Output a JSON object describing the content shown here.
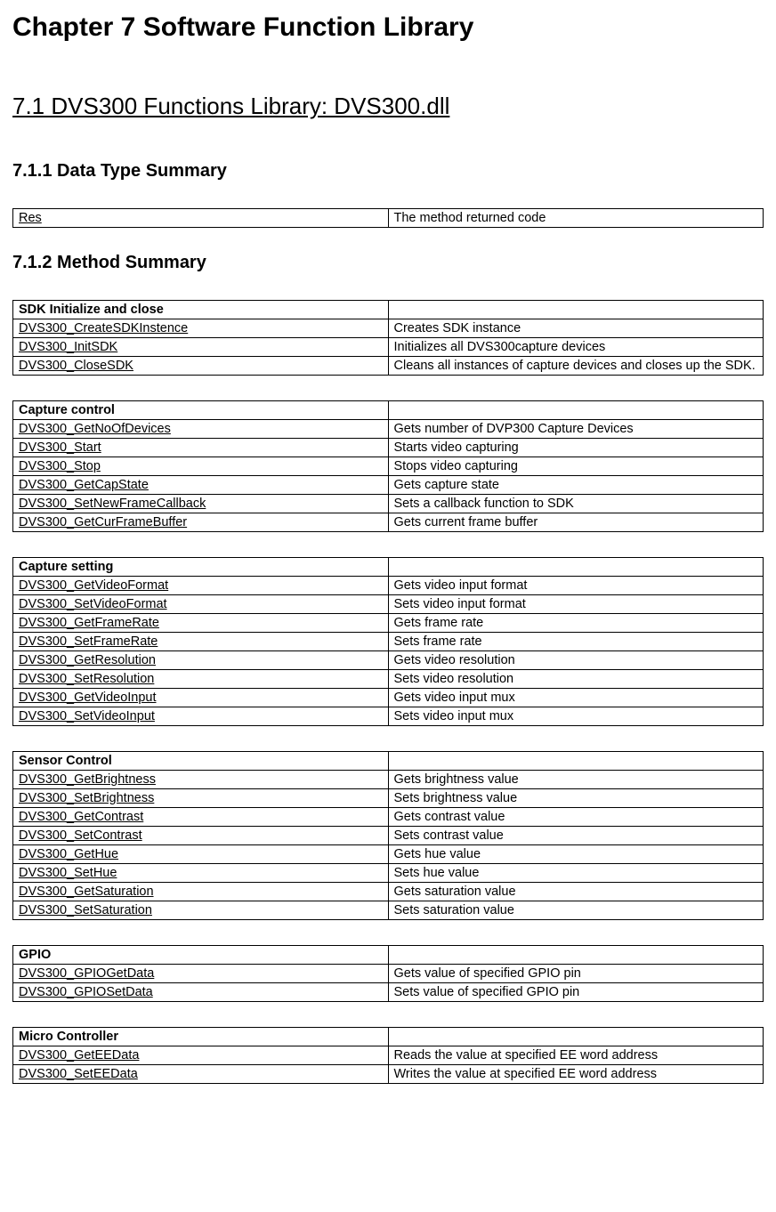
{
  "headings": {
    "chapter": "Chapter 7  Software Function Library",
    "section71": "7.1 DVS300 Functions Library: DVS300.dll",
    "section711": "7.1.1 Data Type Summary",
    "section712": "7.1.2 Method Summary"
  },
  "dataTypeTable": {
    "rows": [
      {
        "name": "Res",
        "desc": "The method returned code"
      }
    ]
  },
  "methodTables": [
    {
      "header": "SDK Initialize and close",
      "rows": [
        {
          "name": "DVS300_CreateSDKInstence",
          "desc": "Creates SDK instance"
        },
        {
          "name": "DVS300_InitSDK",
          "desc": "Initializes all DVS300capture devices"
        },
        {
          "name": "DVS300_CloseSDK",
          "desc": "Cleans all instances of capture devices and closes up the SDK."
        }
      ]
    },
    {
      "header": "Capture control",
      "rows": [
        {
          "name": "DVS300_GetNoOfDevices",
          "desc": "Gets number of DVP300 Capture Devices"
        },
        {
          "name": "DVS300_Start",
          "desc": "Starts video capturing"
        },
        {
          "name": "DVS300_Stop",
          "desc": "Stops video capturing"
        },
        {
          "name": "DVS300_GetCapState",
          "desc": "Gets capture state"
        },
        {
          "name": "DVS300_SetNewFrameCallback",
          "desc": "Sets a callback function to SDK"
        },
        {
          "name": "DVS300_GetCurFrameBuffer",
          "desc": "Gets current frame buffer"
        }
      ]
    },
    {
      "header": "Capture setting",
      "rows": [
        {
          "name": "DVS300_GetVideoFormat",
          "desc": "Gets video input format"
        },
        {
          "name": "DVS300_SetVideoFormat",
          "desc": "Sets video input format"
        },
        {
          "name": "DVS300_GetFrameRate",
          "desc": "Gets frame rate"
        },
        {
          "name": "DVS300_SetFrameRate",
          "desc": "Sets frame rate"
        },
        {
          "name": "DVS300_GetResolution",
          "desc": "Gets video resolution"
        },
        {
          "name": "DVS300_SetResolution",
          "desc": "Sets video resolution"
        },
        {
          "name": "DVS300_GetVideoInput",
          "desc": "Gets video input mux"
        },
        {
          "name": "DVS300_SetVideoInput",
          "desc": "Sets video input mux"
        }
      ]
    },
    {
      "header": "Sensor Control",
      "rows": [
        {
          "name": "DVS300_GetBrightness",
          "desc": "Gets brightness value"
        },
        {
          "name": "DVS300_SetBrightness",
          "desc": "Sets brightness value"
        },
        {
          "name": "DVS300_GetContrast",
          "desc": "Gets contrast value"
        },
        {
          "name": "DVS300_SetContrast",
          "desc": "Sets contrast value"
        },
        {
          "name": "DVS300_GetHue",
          "desc": "Gets hue value"
        },
        {
          "name": "DVS300_SetHue",
          "desc": "Sets hue value"
        },
        {
          "name": "DVS300_GetSaturation",
          "desc": "Gets saturation value"
        },
        {
          "name": "DVS300_SetSaturation",
          "desc": "Sets saturation value"
        }
      ]
    },
    {
      "header": "GPIO",
      "rows": [
        {
          "name": "DVS300_GPIOGetData",
          "desc": "Gets value of specified GPIO pin"
        },
        {
          "name": "DVS300_GPIOSetData",
          "desc": "Sets value of specified GPIO pin"
        }
      ]
    },
    {
      "header": "Micro Controller",
      "rows": [
        {
          "name": "DVS300_GetEEData",
          "desc": "Reads the value at specified EE word address"
        },
        {
          "name": "DVS300_SetEEData",
          "desc": "Writes the value at specified EE word address"
        }
      ]
    }
  ]
}
